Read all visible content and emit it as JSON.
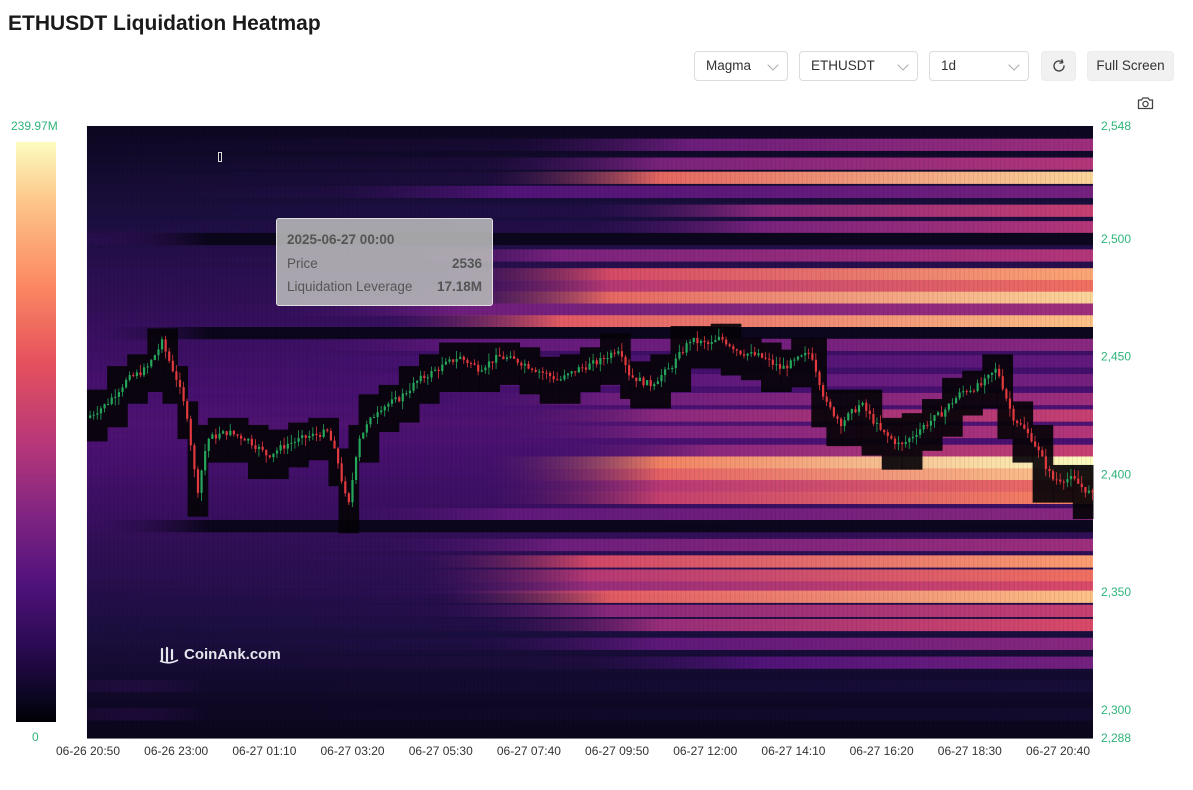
{
  "page": {
    "title": "ETHUSDT Liquidation Heatmap"
  },
  "toolbar": {
    "color_scheme": "Magma",
    "symbol": "ETHUSDT",
    "timeframe": "1d",
    "refresh_icon": "refresh-icon",
    "fullscreen_label": "Full Screen",
    "screenshot_icon": "camera-icon"
  },
  "legend": {
    "max_label": "239.97M",
    "min_label": "0"
  },
  "tooltip": {
    "date": "2025-06-27 00:00",
    "price_label": "Price",
    "price_value": "2536",
    "leverage_label": "Liquidation Leverage",
    "leverage_value": "17.18M"
  },
  "watermark": "CoinAnk.com",
  "colors": {
    "axis_label": "#2fb37a",
    "up_candle": "#26a65b",
    "down_candle": "#e0393e"
  },
  "chart_data": {
    "type": "heatmap",
    "title": "ETHUSDT Liquidation Heatmap",
    "colormap": "magma",
    "color_range": [
      0,
      239.97
    ],
    "color_unit": "M",
    "y_range": [
      2288,
      2548
    ],
    "y_ticks": [
      {
        "value": 2548,
        "label": "2,548"
      },
      {
        "value": 2500,
        "label": "2,500"
      },
      {
        "value": 2450,
        "label": "2,450"
      },
      {
        "value": 2400,
        "label": "2,400"
      },
      {
        "value": 2350,
        "label": "2,350"
      },
      {
        "value": 2300,
        "label": "2,300"
      },
      {
        "value": 2288,
        "label": "2,288"
      }
    ],
    "x_range": [
      "2025-06-26 20:50",
      "2025-06-27 20:40"
    ],
    "x_tick_labels": [
      "06-26 20:50",
      "06-26 23:00",
      "06-27 01:10",
      "06-27 03:20",
      "06-27 05:30",
      "06-27 07:40",
      "06-27 09:50",
      "06-27 12:00",
      "06-27 14:10",
      "06-27 16:20",
      "06-27 18:30",
      "06-27 20:40"
    ],
    "liquidation_bands": [
      {
        "price": 2540,
        "intensity": 0.45,
        "start": 0.48
      },
      {
        "price": 2532,
        "intensity": 0.5,
        "start": 0.45
      },
      {
        "price": 2526,
        "intensity": 0.92,
        "start": 0.45
      },
      {
        "price": 2520,
        "intensity": 0.35,
        "start": 0.3
      },
      {
        "price": 2512,
        "intensity": 0.55,
        "start": 0.55
      },
      {
        "price": 2505,
        "intensity": 0.5,
        "start": 0.55
      },
      {
        "price": 2500,
        "intensity": 0.05,
        "start": 0.0
      },
      {
        "price": 2493,
        "intensity": 0.5,
        "start": 0.35
      },
      {
        "price": 2485,
        "intensity": 0.82,
        "start": 0.4
      },
      {
        "price": 2480,
        "intensity": 0.7,
        "start": 0.4
      },
      {
        "price": 2475,
        "intensity": 0.92,
        "start": 0.4
      },
      {
        "price": 2470,
        "intensity": 0.45,
        "start": 0.25
      },
      {
        "price": 2465,
        "intensity": 0.88,
        "start": 0.35
      },
      {
        "price": 2460,
        "intensity": 0.05,
        "start": 0.0
      },
      {
        "price": 2455,
        "intensity": 0.4,
        "start": 0.25
      },
      {
        "price": 2448,
        "intensity": 0.3,
        "start": 0.2
      },
      {
        "price": 2440,
        "intensity": 0.35,
        "start": 0.25
      },
      {
        "price": 2432,
        "intensity": 0.45,
        "start": 0.4
      },
      {
        "price": 2425,
        "intensity": 0.55,
        "start": 0.45
      },
      {
        "price": 2418,
        "intensity": 0.5,
        "start": 0.45
      },
      {
        "price": 2410,
        "intensity": 0.55,
        "start": 0.5
      },
      {
        "price": 2405,
        "intensity": 1.0,
        "start": 0.45
      },
      {
        "price": 2400,
        "intensity": 0.9,
        "start": 0.45
      },
      {
        "price": 2395,
        "intensity": 0.7,
        "start": 0.45
      },
      {
        "price": 2390,
        "intensity": 0.75,
        "start": 0.45
      },
      {
        "price": 2383,
        "intensity": 0.4,
        "start": 0.3
      },
      {
        "price": 2378,
        "intensity": 0.05,
        "start": 0.0
      },
      {
        "price": 2370,
        "intensity": 0.45,
        "start": 0.35
      },
      {
        "price": 2363,
        "intensity": 0.8,
        "start": 0.38
      },
      {
        "price": 2357,
        "intensity": 0.7,
        "start": 0.38
      },
      {
        "price": 2352,
        "intensity": 0.6,
        "start": 0.38
      },
      {
        "price": 2348,
        "intensity": 0.88,
        "start": 0.4
      },
      {
        "price": 2342,
        "intensity": 0.55,
        "start": 0.4
      },
      {
        "price": 2336,
        "intensity": 0.6,
        "start": 0.45
      },
      {
        "price": 2328,
        "intensity": 0.4,
        "start": 0.45
      },
      {
        "price": 2320,
        "intensity": 0.35,
        "start": 0.55
      },
      {
        "price": 2310,
        "intensity": 0.1,
        "start": 0.0
      },
      {
        "price": 2298,
        "intensity": 0.08,
        "start": 0.0
      }
    ],
    "price_path": [
      [
        0.0,
        2424
      ],
      [
        0.02,
        2430
      ],
      [
        0.04,
        2440
      ],
      [
        0.06,
        2445
      ],
      [
        0.075,
        2456
      ],
      [
        0.09,
        2440
      ],
      [
        0.1,
        2425
      ],
      [
        0.11,
        2392
      ],
      [
        0.12,
        2415
      ],
      [
        0.14,
        2418
      ],
      [
        0.16,
        2415
      ],
      [
        0.18,
        2408
      ],
      [
        0.2,
        2413
      ],
      [
        0.22,
        2416
      ],
      [
        0.24,
        2418
      ],
      [
        0.25,
        2405
      ],
      [
        0.26,
        2385
      ],
      [
        0.27,
        2415
      ],
      [
        0.29,
        2428
      ],
      [
        0.31,
        2432
      ],
      [
        0.33,
        2440
      ],
      [
        0.35,
        2445
      ],
      [
        0.37,
        2450
      ],
      [
        0.39,
        2445
      ],
      [
        0.41,
        2450
      ],
      [
        0.43,
        2448
      ],
      [
        0.45,
        2444
      ],
      [
        0.47,
        2440
      ],
      [
        0.49,
        2445
      ],
      [
        0.51,
        2448
      ],
      [
        0.53,
        2454
      ],
      [
        0.54,
        2442
      ],
      [
        0.56,
        2438
      ],
      [
        0.58,
        2445
      ],
      [
        0.6,
        2457
      ],
      [
        0.62,
        2455
      ],
      [
        0.63,
        2458
      ],
      [
        0.65,
        2452
      ],
      [
        0.67,
        2450
      ],
      [
        0.69,
        2445
      ],
      [
        0.7,
        2447
      ],
      [
        0.72,
        2452
      ],
      [
        0.735,
        2430
      ],
      [
        0.75,
        2422
      ],
      [
        0.77,
        2430
      ],
      [
        0.79,
        2418
      ],
      [
        0.81,
        2412
      ],
      [
        0.83,
        2420
      ],
      [
        0.85,
        2426
      ],
      [
        0.87,
        2435
      ],
      [
        0.89,
        2438
      ],
      [
        0.905,
        2445
      ],
      [
        0.92,
        2425
      ],
      [
        0.94,
        2415
      ],
      [
        0.96,
        2398
      ],
      [
        0.98,
        2398
      ],
      [
        1.0,
        2391
      ]
    ]
  }
}
